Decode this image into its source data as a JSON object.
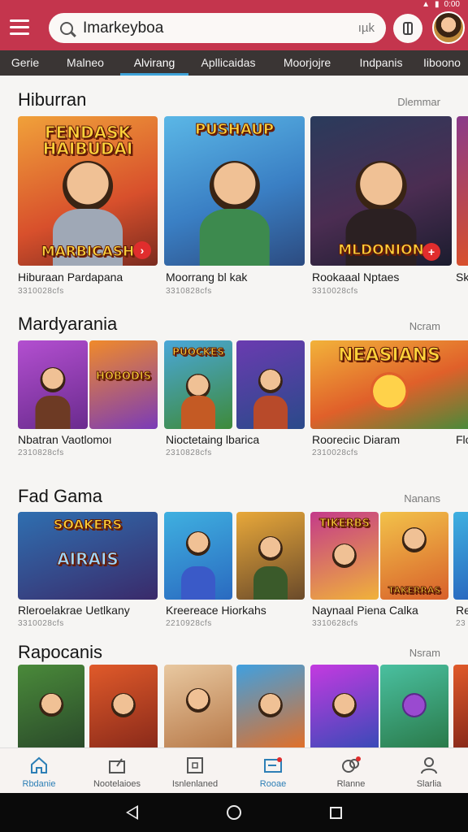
{
  "header": {
    "search_query": "Imarkeyboa",
    "search_hint": "ıµk",
    "status_icons": [
      "▲",
      "▮",
      "0:00"
    ]
  },
  "tabs": [
    {
      "label": "Gerie",
      "active": false
    },
    {
      "label": "Malneo",
      "active": false
    },
    {
      "label": "Alvirang",
      "active": true
    },
    {
      "label": "Apllicaidas",
      "active": false
    },
    {
      "label": "Moorjojre",
      "active": false
    },
    {
      "label": "Indpanis",
      "active": false
    },
    {
      "label": "Iiboono",
      "active": false
    }
  ],
  "sections": [
    {
      "title": "Hiburran",
      "more": "Dlemmar",
      "cards": [
        {
          "title": "Hiburaan Pardapana",
          "meta": "3310028cfs",
          "art_text": "FENDASK HAIBUDAI",
          "art_text2": "MARBICASH",
          "badge": "›"
        },
        {
          "title": "Moorrang bl kak",
          "meta": "3310828cfs",
          "art_text": "PUSHAUP",
          "art_text2": "",
          "badge": ""
        },
        {
          "title": "Rookaaal Nptaes",
          "meta": "3310028cfs",
          "art_text": "",
          "art_text2": "MLDONION",
          "badge": "+"
        },
        {
          "title": "Sk",
          "meta": "",
          "art_text": "",
          "art_text2": "",
          "badge": ""
        }
      ]
    },
    {
      "title": "Mardyarania",
      "more": "Ncram",
      "cards": [
        {
          "title": "Nbatran Vaotlomoı",
          "meta": "2310828cfs",
          "art_text": "",
          "art_text2": "HOBODIS",
          "badge": ""
        },
        {
          "title": "Nioctetaing lbarica",
          "meta": "2310828cfs",
          "art_text": "PUOCKES",
          "art_text2": "",
          "badge": ""
        },
        {
          "title": "Rooreciıc Diaram",
          "meta": "2310028cfs",
          "art_text": "NEASIANS",
          "art_text2": "",
          "badge": ""
        },
        {
          "title": "Flo",
          "meta": "",
          "art_text": "",
          "art_text2": "",
          "badge": ""
        }
      ]
    },
    {
      "title": "Fad Gama",
      "more": "Nanans",
      "cards": [
        {
          "title": "Rleroelakrae Uetlkany",
          "meta": "3310028cfs",
          "art_text": "SOAKERS",
          "art_text2": "AIRAIS",
          "badge": ""
        },
        {
          "title": "Kreereace Hiorkahs",
          "meta": "2210928cfs",
          "art_text": "",
          "art_text2": "",
          "badge": ""
        },
        {
          "title": "Naynaal Piena Calka",
          "meta": "3310628cfs",
          "art_text": "TIKERBS",
          "art_text2": "TAKERRAS",
          "badge": ""
        },
        {
          "title": "Re",
          "meta": "23",
          "art_text": "",
          "art_text2": "",
          "badge": ""
        }
      ]
    },
    {
      "title": "Rapocanis",
      "more": "Nsram",
      "cards": []
    }
  ],
  "bottom_nav": [
    {
      "label": "Rbdanie",
      "icon": "home-icon",
      "active": true
    },
    {
      "label": "Nootelaioes",
      "icon": "share-icon",
      "active": false
    },
    {
      "label": "Isnlenlaned",
      "icon": "calendar-icon",
      "active": false
    },
    {
      "label": "Rooae",
      "icon": "mail-icon",
      "active": true
    },
    {
      "label": "Rlanne",
      "icon": "chat-icon",
      "active": false
    },
    {
      "label": "Slarlia",
      "icon": "profile-icon",
      "active": false
    }
  ],
  "colors": {
    "appbar": "#c4354d",
    "tabbar": "#3a3534",
    "tab_active_underline": "#3fa3d8",
    "badge": "#e02d2d"
  }
}
